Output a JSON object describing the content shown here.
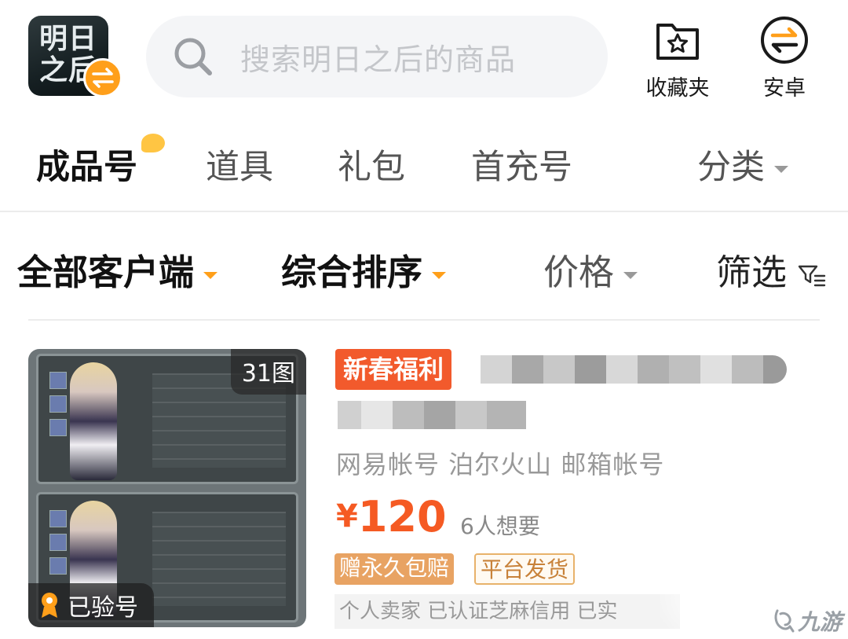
{
  "header": {
    "logo_text": "明日之后",
    "search_placeholder": "搜索明日之后的商品",
    "favorites_label": "收藏夹",
    "platform_label": "安卓"
  },
  "tabs": [
    {
      "label": "成品号",
      "active": true
    },
    {
      "label": "道具",
      "active": false
    },
    {
      "label": "礼包",
      "active": false
    },
    {
      "label": "首充号",
      "active": false
    },
    {
      "label": "分类",
      "active": false
    }
  ],
  "filters": {
    "client": "全部客户端",
    "sort": "综合排序",
    "price": "价格",
    "filter": "筛选"
  },
  "product": {
    "photo_count": "31图",
    "verified_label": "已验号",
    "promo_tag": "新春福利",
    "account_tags": "网易帐号 泊尔火山 邮箱帐号",
    "currency": "¥",
    "price": "120",
    "wants": "6人想要",
    "perk_1": "赠永久包赔",
    "perk_2": "平台发货",
    "seller_info": "个人卖家  已认证芝麻信用  已实"
  },
  "watermark": {
    "text": "九游"
  },
  "colors": {
    "accent": "#ff9f1a",
    "price": "#f55a23",
    "promo": "#f25a2c"
  }
}
